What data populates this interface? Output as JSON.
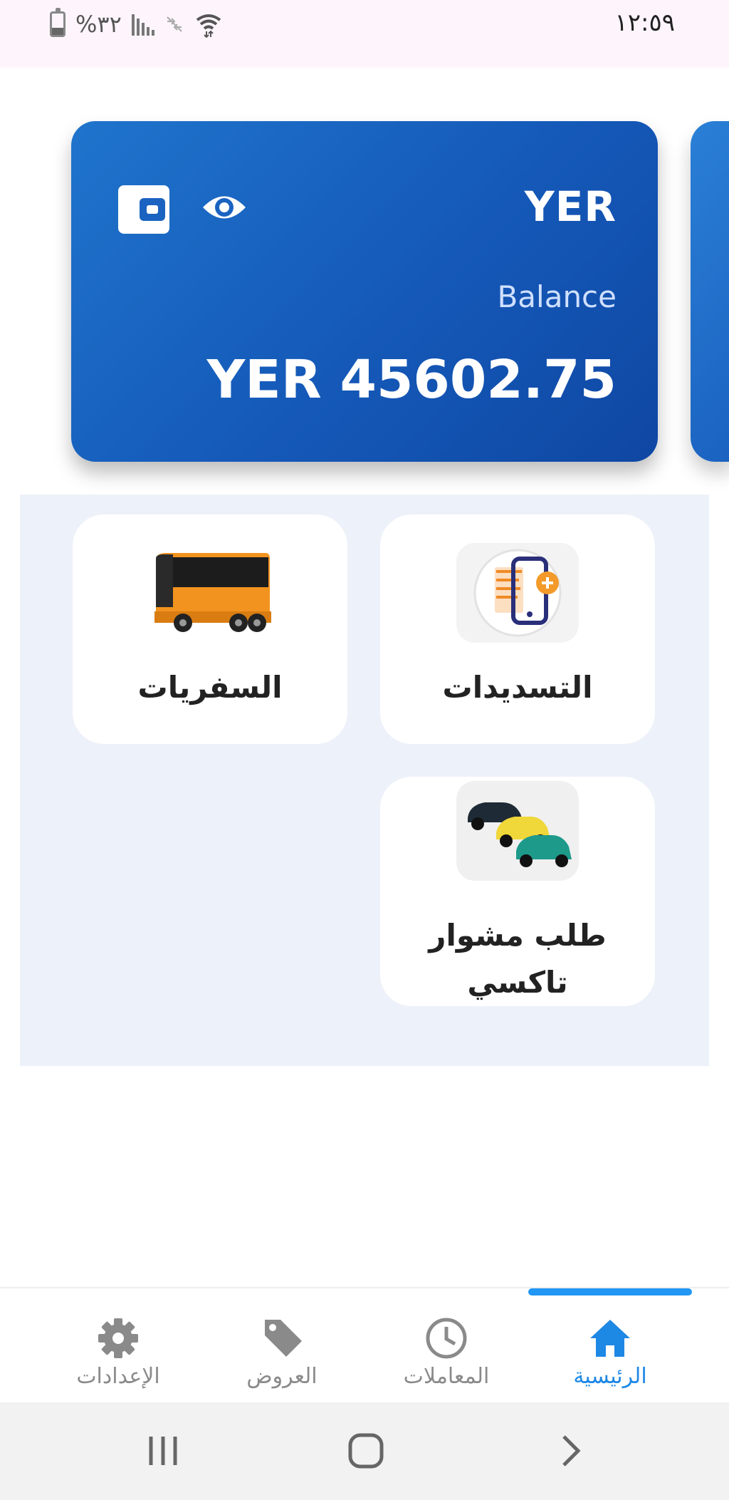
{
  "status_bar": {
    "time": "١٢:٥٩",
    "battery_percent": "%٣٢"
  },
  "balance_card": {
    "currency": "YER",
    "balance_label": "Balance",
    "amount": "YER 45602.75",
    "colors": {
      "gradient_start": "#1f74cc",
      "gradient_end": "#0f47a3"
    }
  },
  "services": [
    {
      "label": "التسديدات",
      "icon": "bill-payment-icon"
    },
    {
      "label": "السفريات",
      "icon": "bus-icon"
    },
    {
      "label": "طلب مشوار تاكسي",
      "icon": "taxi-cars-icon"
    }
  ],
  "bottom_nav": {
    "items": [
      {
        "label": "الرئيسية",
        "icon": "home-icon",
        "active": true
      },
      {
        "label": "المعاملات",
        "icon": "clock-icon",
        "active": false
      },
      {
        "label": "العروض",
        "icon": "tag-icon",
        "active": false
      },
      {
        "label": "الإعدادات",
        "icon": "gear-icon",
        "active": false
      }
    ],
    "accent_color": "#1e88e5"
  },
  "system_nav": {
    "buttons": [
      "recent-apps-icon",
      "home-circle-icon",
      "back-chevron-icon"
    ]
  }
}
